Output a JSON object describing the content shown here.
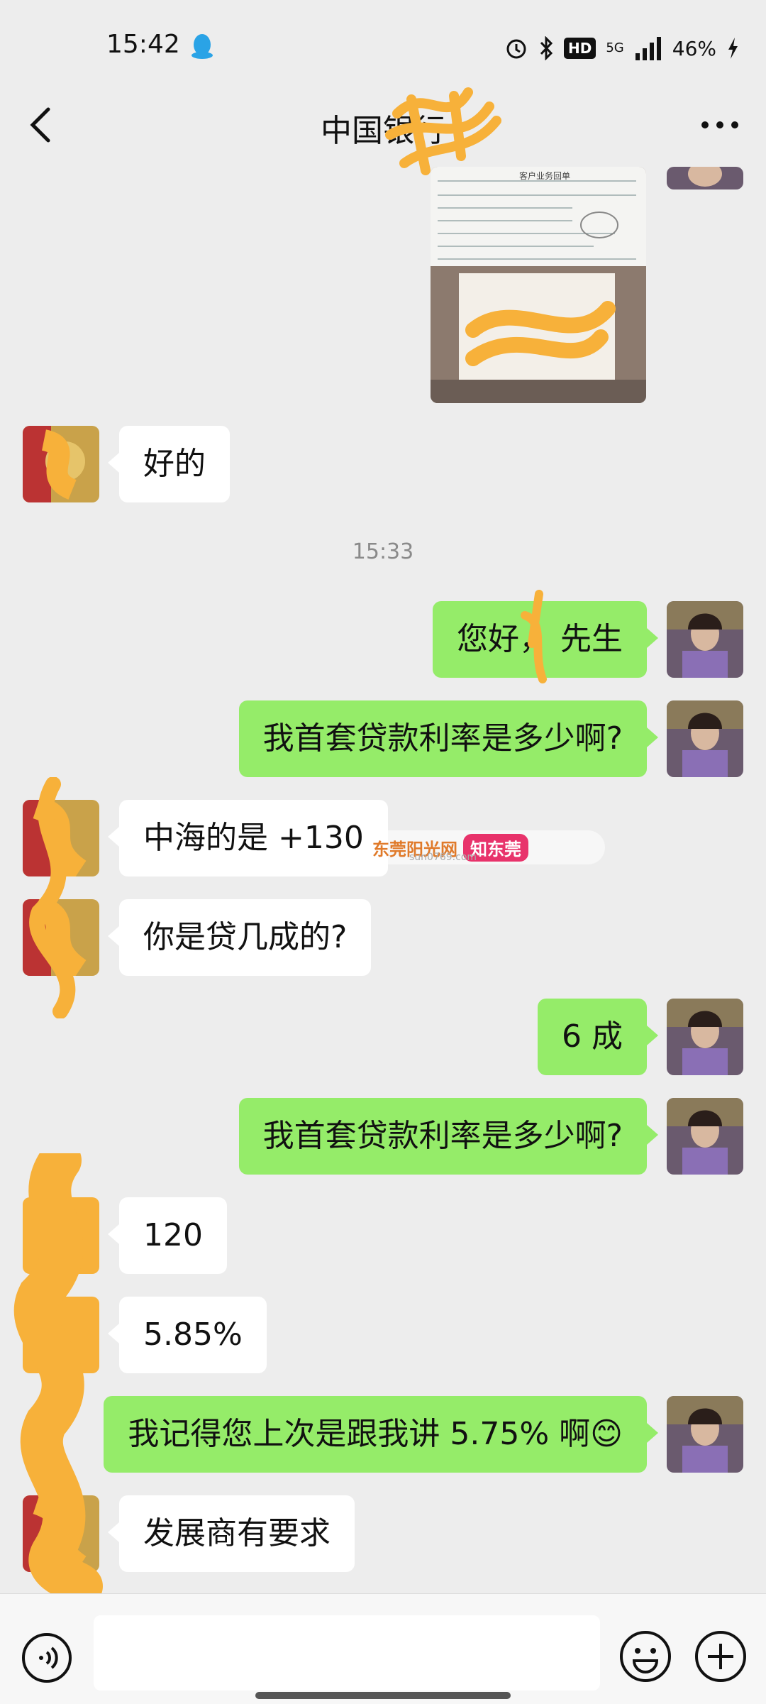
{
  "status": {
    "time": "15:42",
    "network": "5G",
    "battery": "46%",
    "hd": "HD"
  },
  "nav": {
    "title": "中国银行"
  },
  "watermark": {
    "brand1": "东莞阳光网",
    "site": "sun0769.com",
    "brand2": "知东莞"
  },
  "messages": [
    {
      "type": "image",
      "side": "left",
      "caption": "客户业务回单"
    },
    {
      "type": "text",
      "side": "left",
      "text": "好的"
    },
    {
      "type": "time",
      "text": "15:33"
    },
    {
      "type": "text",
      "side": "right",
      "text": "您好，  先生"
    },
    {
      "type": "text",
      "side": "right",
      "text": "我首套贷款利率是多少啊?"
    },
    {
      "type": "text",
      "side": "left",
      "text": "中海的是 +130"
    },
    {
      "type": "text",
      "side": "left",
      "text": "你是贷几成的?"
    },
    {
      "type": "text",
      "side": "right",
      "text": "6 成"
    },
    {
      "type": "text",
      "side": "right",
      "text": "我首套贷款利率是多少啊?"
    },
    {
      "type": "text",
      "side": "left",
      "text": "120"
    },
    {
      "type": "text",
      "side": "left",
      "text": "5.85%"
    },
    {
      "type": "text",
      "side": "right",
      "text": "我记得您上次是跟我讲 5.75% 啊",
      "emoji": "😊"
    },
    {
      "type": "text",
      "side": "left",
      "text": "发展商有要求"
    }
  ],
  "input": {
    "placeholder": ""
  },
  "colors": {
    "outgoing_bubble": "#95ec69",
    "incoming_bubble": "#ffffff",
    "background": "#ededed",
    "scribble": "#f7b13a"
  }
}
